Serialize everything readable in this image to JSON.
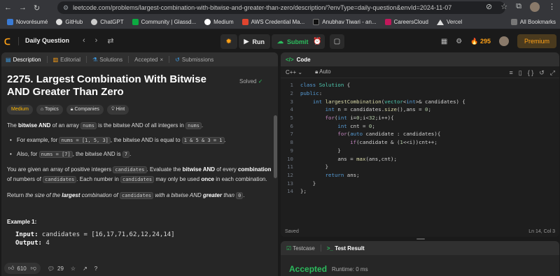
{
  "browser": {
    "url": "leetcode.com/problems/largest-combination-with-bitwise-and-greater-than-zero/description/?envType=daily-question&envId=2024-11-07",
    "bookmarks": [
      "Novorésumé",
      "GitHub",
      "ChatGPT",
      "Community | Glassd...",
      "Medium",
      "AWS Credential Ma...",
      "Anubhav Tiwari - an...",
      "CareersCloud",
      "Vercel"
    ],
    "all_bookmarks": "All Bookmarks"
  },
  "topbar": {
    "daily_question": "Daily Question",
    "run_label": "Run",
    "submit_label": "Submit",
    "streak": "295",
    "premium_label": "Premium"
  },
  "left_tabs": [
    "Description",
    "Editorial",
    "Solutions",
    "Accepted",
    "Submissions"
  ],
  "problem": {
    "title": "2275. Largest Combination With Bitwise AND Greater Than Zero",
    "solved_label": "Solved",
    "chips": [
      "Medium",
      "Topics",
      "Companies",
      "Hint"
    ],
    "p1_pre": "The ",
    "p1_bold": "bitwise AND",
    "p1_mid": " of an array ",
    "p1_code1": "nums",
    "p1_mid2": " is the bitwise AND of all integers in ",
    "p1_code2": "nums",
    "p1_end": ".",
    "b1_pre": "For example, for ",
    "b1_code1": "nums = [1, 5, 3]",
    "b1_mid": ", the bitwise AND is equal to ",
    "b1_code2": "1 & 5 & 3 = 1",
    "b1_end": ".",
    "b2_pre": "Also, for ",
    "b2_code1": "nums = [7]",
    "b2_mid": ", the bitwise AND is ",
    "b2_code2": "7",
    "b2_end": ".",
    "p2_a": "You are given an array of positive integers ",
    "p2_code1": "candidates",
    "p2_b": ". Evaluate the ",
    "p2_bold1": "bitwise AND",
    "p2_c": " of every ",
    "p2_bold2": "combination",
    "p2_d": " of numbers of ",
    "p2_code2": "candidates",
    "p2_e": ". Each number in ",
    "p2_code3": "candidates",
    "p2_f": " may only be used ",
    "p2_bold3": "once",
    "p2_g": " in each combination.",
    "p3_a": "Return ",
    "p3_i1": "the size of the ",
    "p3_bold1": "largest",
    "p3_i2": " combination of ",
    "p3_code1": "candidates",
    "p3_i3": " with a bitwise AND ",
    "p3_bold2": "greater",
    "p3_i4": " than ",
    "p3_code2": "0",
    "p3_end": ".",
    "example_title": "Example 1:",
    "input_label": "Input:",
    "input_value": " candidates = [16,17,71,62,12,24,14]",
    "output_label": "Output:",
    "output_value": " 4"
  },
  "left_bottom": {
    "likes": "610",
    "comments": "29"
  },
  "code_panel": {
    "title": "Code",
    "language": "C++",
    "mode": "Auto",
    "status_saved": "Saved",
    "cursor": "Ln 14, Col 3",
    "lines": [
      "class Solution {",
      "public:",
      "    int largestCombination(vector<int>& candidates) {",
      "        int n = candidates.size(),ans = 0;",
      "        for(int i=0;i<32;i++){",
      "            int cnt = 0;",
      "            for(auto candidate : candidates){",
      "                if(candidate & (1<<i))cnt++;",
      "            }",
      "            ans = max(ans,cnt);",
      "        }",
      "        return ans;",
      "    }",
      "};"
    ]
  },
  "result_panel": {
    "testcase_tab": "Testcase",
    "result_tab": "Test Result",
    "status": "Accepted",
    "runtime": "Runtime: 0 ms"
  }
}
